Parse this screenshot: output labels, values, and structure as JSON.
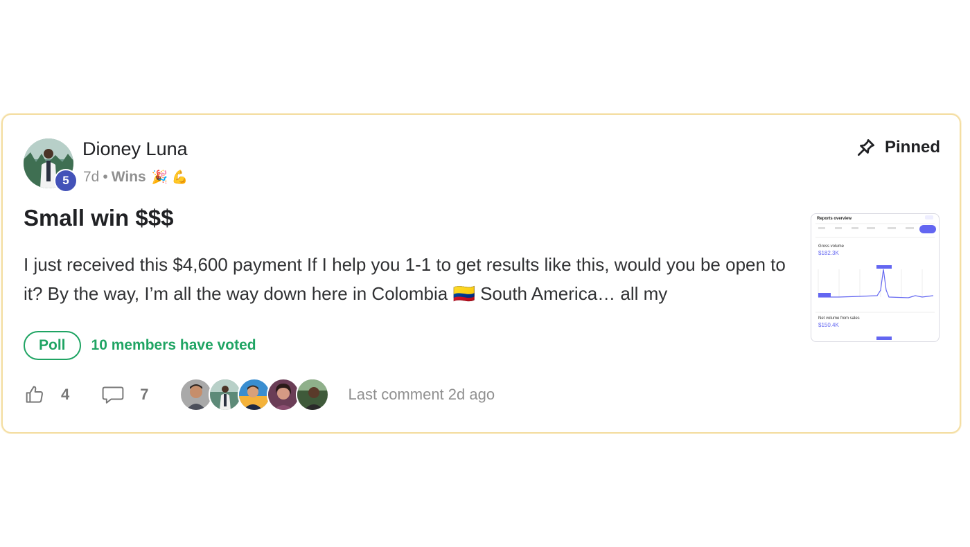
{
  "post": {
    "author": "Dioney Luna",
    "level": "5",
    "age": "7d",
    "separator": "•",
    "category": "Wins",
    "category_emoji": "🎉 💪",
    "pinned_label": "Pinned",
    "title": "Small win $$$",
    "body": "I just received this $4,600 payment If I help you 1-1 to get results like this, would you be open to it? By the way, I’m all the way down here in Colombia 🇨🇴 South America… all my",
    "poll_label": "Poll",
    "poll_votes": "10 members have voted",
    "likes": "4",
    "comments": "7",
    "last_comment": "Last comment 2d ago"
  },
  "thumbnail": {
    "title": "Reports overview",
    "metric1_label": "Gross volume",
    "metric1_value": "$182.3K",
    "metric2_label": "Net volume from sales",
    "metric2_value": "$150.4K"
  },
  "colors": {
    "accent_green": "#1fa463",
    "badge_blue": "#4352b8",
    "card_border": "#f4dea3",
    "chart_purple": "#6366f1"
  }
}
